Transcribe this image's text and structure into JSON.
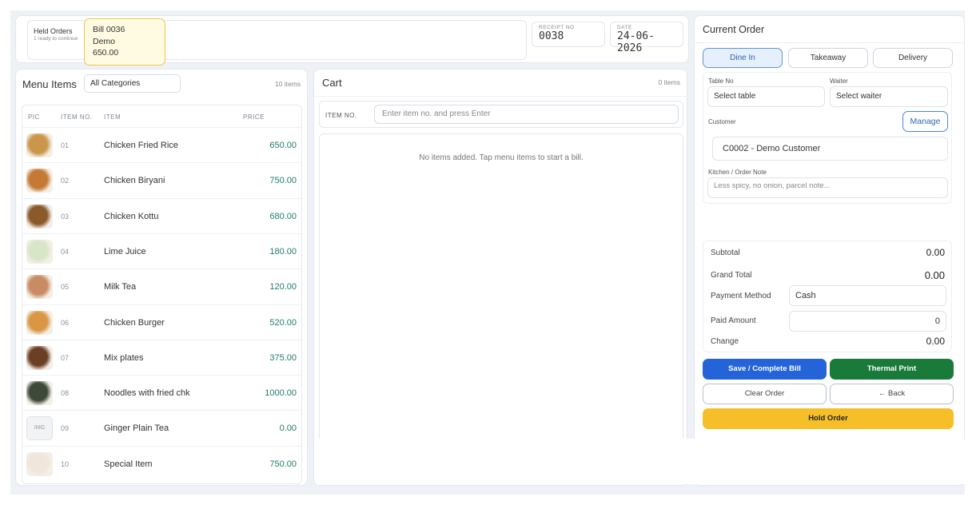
{
  "held": {
    "title": "Held Orders",
    "subtitle": "1 ready to continue",
    "bill_no": "Bill 0036",
    "bill_name": "Demo",
    "bill_amount": "650.00"
  },
  "receipt": {
    "label": "RECEIPT NO",
    "value": "0038"
  },
  "date": {
    "label": "DATE",
    "value": "24-06-2026"
  },
  "menu": {
    "title": "Menu Items",
    "category": "All Categories",
    "count": "10 items",
    "headers": {
      "pic": "PIC",
      "no": "ITEM NO.",
      "item": "ITEM",
      "price": "PRICE"
    },
    "items": [
      {
        "no": "01",
        "name": "Chicken Fried Rice",
        "price": "650.00"
      },
      {
        "no": "02",
        "name": "Chicken Biryani",
        "price": "750.00"
      },
      {
        "no": "03",
        "name": "Chicken Kottu",
        "price": "680.00"
      },
      {
        "no": "04",
        "name": "Lime Juice",
        "price": "180.00"
      },
      {
        "no": "05",
        "name": "Milk Tea",
        "price": "120.00"
      },
      {
        "no": "06",
        "name": "Chicken Burger",
        "price": "520.00"
      },
      {
        "no": "07",
        "name": "Mix plates",
        "price": "375.00"
      },
      {
        "no": "08",
        "name": "Noodles with fried chk",
        "price": "1000.00"
      },
      {
        "no": "09",
        "name": "Ginger Plain Tea",
        "price": "0.00",
        "thumb": "IMG"
      },
      {
        "no": "10",
        "name": "Special Item",
        "price": "750.00"
      }
    ],
    "thumb_colors": [
      "#c9964a",
      "#c47a34",
      "#8a5a2b",
      "#d7e6c8",
      "#c98b63",
      "#d99744",
      "#6b3f25",
      "#3d4a3a",
      "#f2f3f5",
      "#efe6dc"
    ]
  },
  "cart": {
    "title": "Cart",
    "count": "0 items",
    "entry_label": "ITEM NO.",
    "entry_placeholder": "Enter item no. and press Enter",
    "empty": "No items added. Tap menu items to start a bill."
  },
  "order": {
    "title": "Current Order",
    "tabs": [
      "Dine In",
      "Takeaway",
      "Delivery"
    ],
    "table_label": "Table No",
    "table_value": "Select table",
    "waiter_label": "Waiter",
    "waiter_value": "Select waiter",
    "customer_label": "Customer",
    "manage": "Manage",
    "customer_value": "C0002 - Demo Customer",
    "note_label": "Kitchen / Order Note",
    "note_placeholder": "Less spicy, no onion, parcel note...",
    "subtotal_label": "Subtotal",
    "subtotal": "0.00",
    "grand_label": "Grand Total",
    "grand": "0.00",
    "pay_label": "Payment Method",
    "pay_value": "Cash",
    "paid_label": "Paid Amount",
    "paid_value": "0",
    "change_label": "Change",
    "change": "0.00",
    "save": "Save / Complete Bill",
    "print": "Thermal Print",
    "clear": "Clear Order",
    "back": "← Back",
    "hold": "Hold Order"
  },
  "colors": {
    "accent": "#2e63b6",
    "save": "#2563d9",
    "print": "#1a7a3a",
    "hold": "#f6bf2a",
    "price": "#1d7d6b"
  }
}
